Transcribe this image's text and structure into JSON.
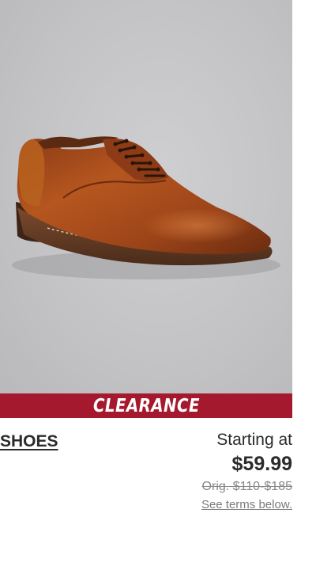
{
  "product": {
    "image_alt": "Brown leather derby dress shoe",
    "banner_label": "CLEARANCE",
    "category_label": "SHOES",
    "starting_at_label": "Starting at",
    "price": "$59.99",
    "original_price": "Orig. $110-$185",
    "terms_link": "See terms below."
  },
  "colors": {
    "banner": "#a5192e",
    "text": "#2b2b2b",
    "muted": "#888888"
  }
}
